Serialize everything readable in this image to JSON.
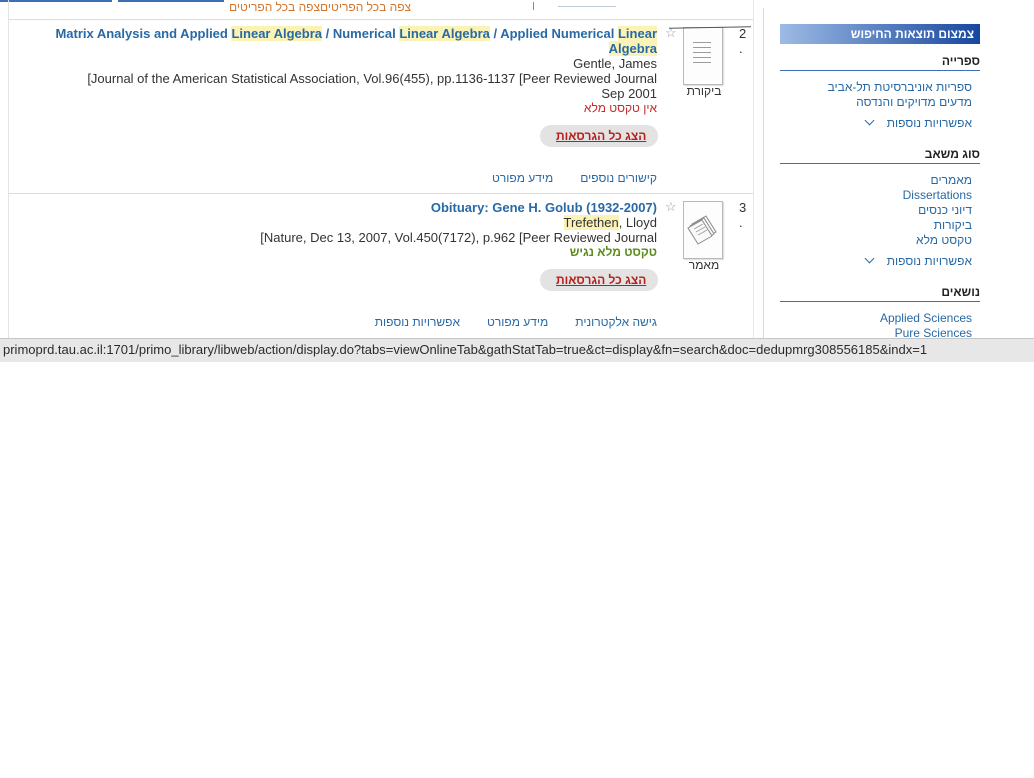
{
  "top": {
    "clipped_link_text": "צפה בכל הפריטים‎צפה בכל הפריטים"
  },
  "sidebar": {
    "header": "צמצום תוצאות החיפוש",
    "facets": [
      {
        "title": "ספרייה",
        "items": [
          "ספריות אוניברסיטת תל-אביב",
          "מדעים מדויקים והנדסה"
        ],
        "more": "אפשרויות נוספות"
      },
      {
        "title": "סוג משאב",
        "items": [
          "מאמרים",
          "Dissertations",
          "דיוני כנסים",
          "ביקורות",
          "טקסט מלא"
        ],
        "more": "אפשרויות נוספות"
      },
      {
        "title": "נושאים",
        "items": [
          "Applied Sciences",
          "Pure Sciences"
        ]
      }
    ]
  },
  "results": [
    {
      "number": "2 .",
      "icon": "review-document-icon",
      "type_label": "ביקורת",
      "title_parts": [
        "Matrix Analysis and Applied ",
        "Linear Algebra",
        " / Numerical ",
        "Linear Algebra",
        " / Applied Numerical ",
        "Linear",
        " ",
        "Algebra"
      ],
      "author": "Gentle, James",
      "source": "[Journal of the American Statistical Association, Vol.96(455), pp.1136-1137 [Peer Reviewed Journal",
      "date": "Sep 2001",
      "availability": "אין טקסט מלא",
      "versions_button": "הצג כל הגרסאות",
      "links": [
        "קישורים נוספים",
        "מידע מפורט"
      ]
    },
    {
      "number": "3 .",
      "icon": "article-document-icon",
      "type_label": "מאמר",
      "title": "Obituary: Gene H. Golub (1932-2007)",
      "author_highlight": "Trefethen",
      "author_rest": ", Lloyd",
      "source": "[Nature, Dec 13, 2007, Vol.450(7172), p.962 [Peer Reviewed Journal",
      "availability": "טקסט מלא נגיש",
      "versions_button": "הצג כל הגרסאות",
      "links": [
        "גישה אלקטרונית",
        "מידע מפורט",
        "אפשרויות נוספות"
      ]
    }
  ],
  "status_bar": {
    "url": "primoprd.tau.ac.il:1701/primo_library/libweb/action/display.do?tabs=viewOnlineTab&gathStatTab=true&ct=display&fn=search&doc=dedupmrg308556185&indx=1"
  }
}
